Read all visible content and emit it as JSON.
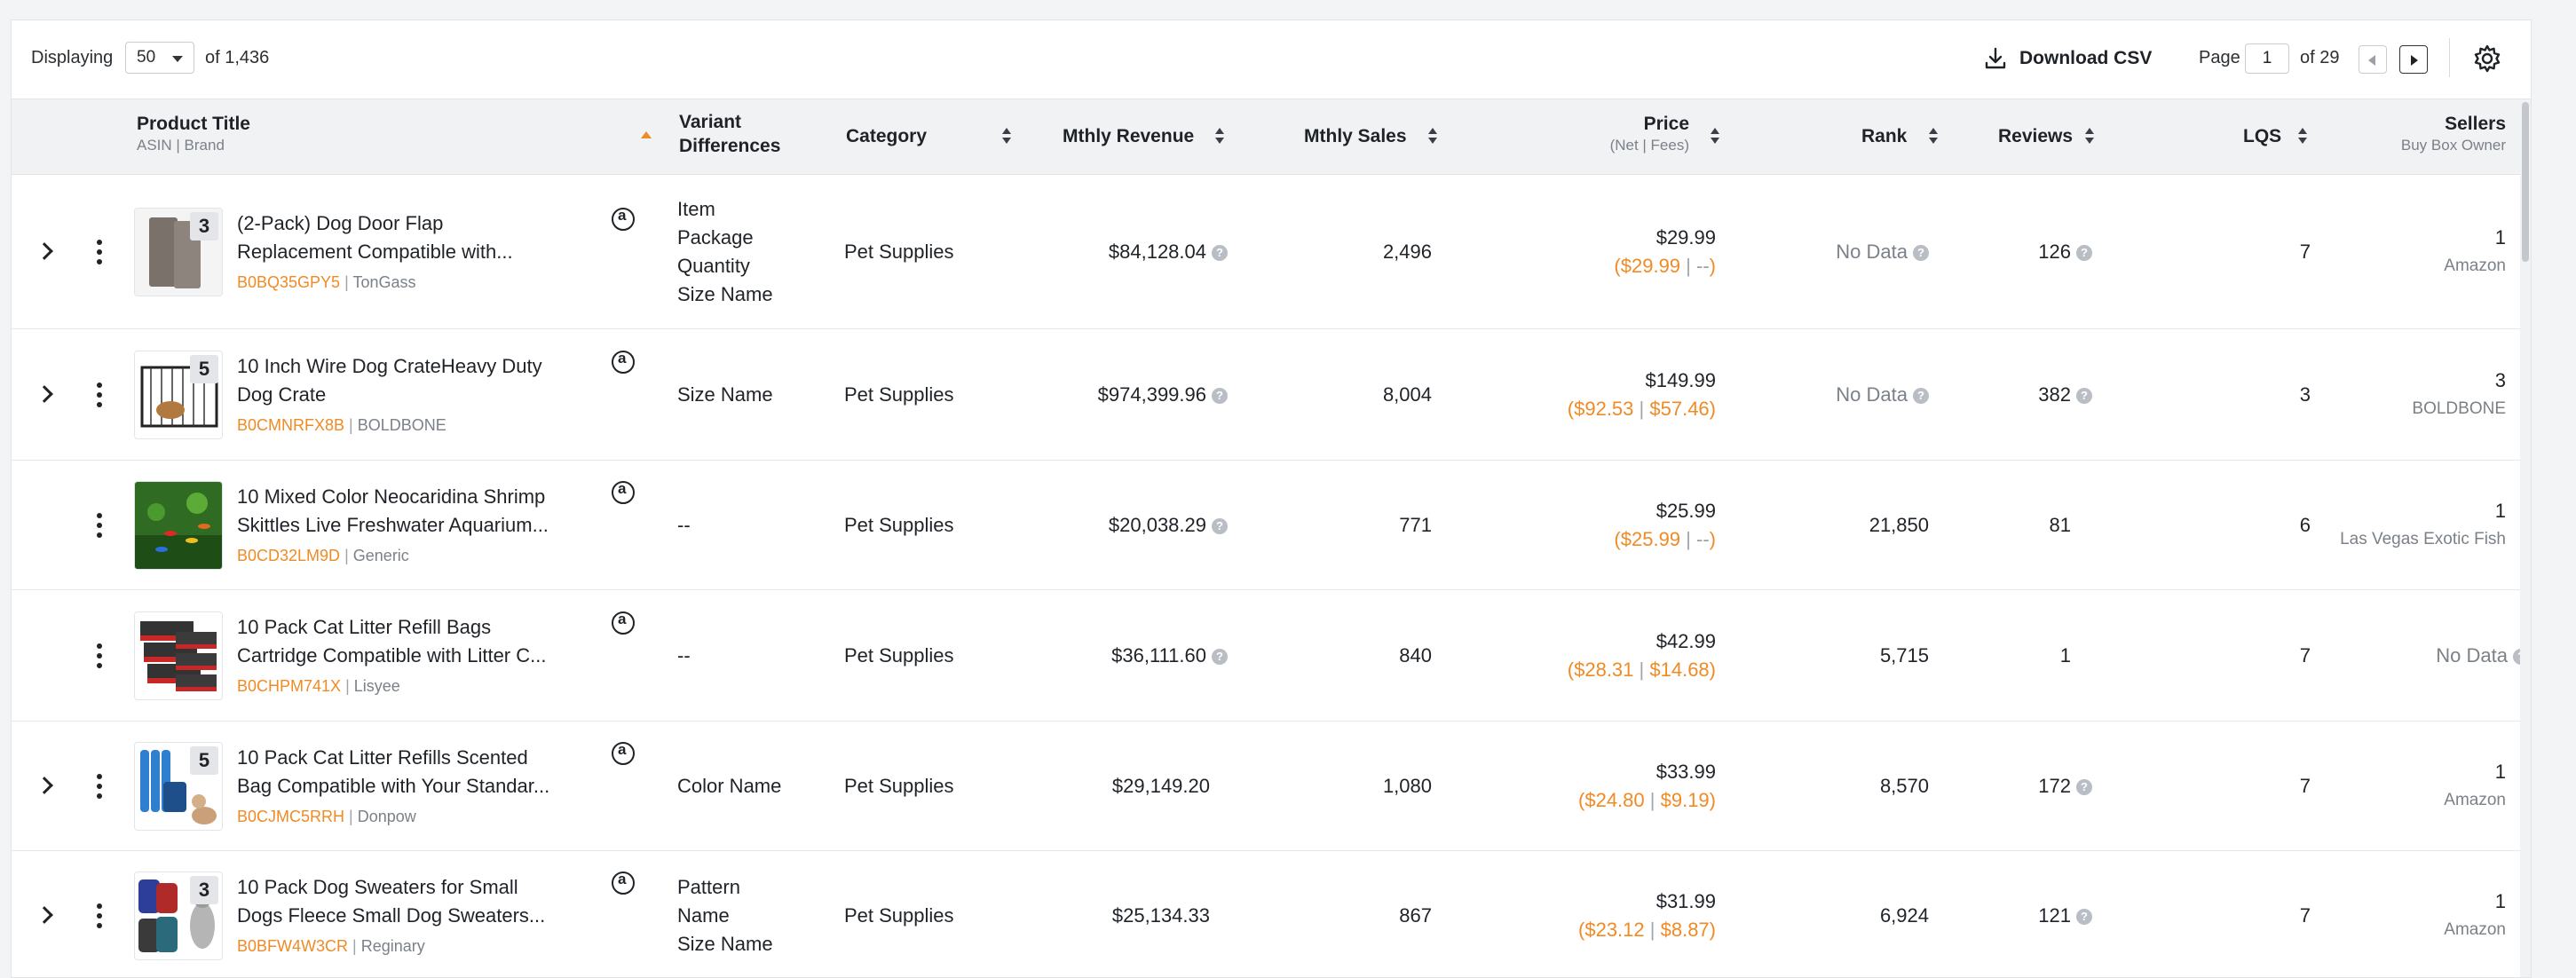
{
  "toolbar": {
    "displaying_label": "Displaying",
    "per_page": "50",
    "of_total": "of 1,436",
    "download_label": "Download CSV",
    "page_label": "Page",
    "page_value": "1",
    "of_pages": "of 29",
    "icons": [
      "download-icon",
      "prev-page-icon",
      "next-page-icon",
      "gear-icon"
    ]
  },
  "columns": {
    "title": "Product Title",
    "title_sub": "ASIN | Brand",
    "variant": "Variant Differences",
    "category": "Category",
    "revenue": "Mthly Revenue",
    "sales": "Mthly Sales",
    "price": "Price",
    "price_sub": "(Net | Fees)",
    "rank": "Rank",
    "reviews": "Reviews",
    "lqs": "LQS",
    "sellers": "Sellers",
    "sellers_sub": "Buy Box Owner"
  },
  "rows": [
    {
      "has_expand": true,
      "badge": "3",
      "title1": "(2-Pack) Dog Door Flap",
      "title2": "Replacement Compatible with...",
      "asin": "B0BQ35GPY5",
      "brand": "TonGass",
      "variant": [
        "Item",
        "Package",
        "Quantity",
        "Size Name"
      ],
      "category": "Pet Supplies",
      "revenue": "$84,128.04",
      "revenue_q": true,
      "sales": "2,496",
      "price": "$29.99",
      "net": "$29.99",
      "fees": "--",
      "rank": "No Data",
      "rank_q": true,
      "reviews": "126",
      "reviews_q": true,
      "lqs": "7",
      "sellers": "1",
      "buybox": "Amazon"
    },
    {
      "has_expand": true,
      "badge": "5",
      "title1": "10 Inch Wire Dog CrateHeavy Duty",
      "title2": "Dog Crate",
      "asin": "B0CMNRFX8B",
      "brand": "BOLDBONE",
      "variant": [
        "Size Name"
      ],
      "category": "Pet Supplies",
      "revenue": "$974,399.96",
      "revenue_q": true,
      "sales": "8,004",
      "price": "$149.99",
      "net": "$92.53",
      "fees": "$57.46",
      "rank": "No Data",
      "rank_q": true,
      "reviews": "382",
      "reviews_q": true,
      "lqs": "3",
      "sellers": "3",
      "buybox": "BOLDBONE"
    },
    {
      "has_expand": false,
      "badge": "",
      "title1": "10 Mixed Color Neocaridina Shrimp",
      "title2": "Skittles Live Freshwater Aquarium...",
      "asin": "B0CD32LM9D",
      "brand": "Generic",
      "variant": [
        "--"
      ],
      "category": "Pet Supplies",
      "revenue": "$20,038.29",
      "revenue_q": true,
      "sales": "771",
      "price": "$25.99",
      "net": "$25.99",
      "fees": "--",
      "rank": "21,850",
      "rank_q": false,
      "reviews": "81",
      "reviews_q": false,
      "lqs": "6",
      "sellers": "1",
      "buybox": "Las Vegas Exotic Fish"
    },
    {
      "has_expand": false,
      "badge": "",
      "title1": "10 Pack Cat Litter Refill Bags",
      "title2": "Cartridge Compatible with Litter C...",
      "asin": "B0CHPM741X",
      "brand": "Lisyee",
      "variant": [
        "--"
      ],
      "category": "Pet Supplies",
      "revenue": "$36,111.60",
      "revenue_q": true,
      "sales": "840",
      "price": "$42.99",
      "net": "$28.31",
      "fees": "$14.68",
      "rank": "5,715",
      "rank_q": false,
      "reviews": "1",
      "reviews_q": false,
      "lqs": "7",
      "sellers": "No Data",
      "buybox": ""
    },
    {
      "has_expand": true,
      "badge": "5",
      "title1": "10 Pack Cat Litter Refills Scented",
      "title2": "Bag Compatible with Your Standar...",
      "asin": "B0CJMC5RRH",
      "brand": "Donpow",
      "variant": [
        "Color Name"
      ],
      "category": "Pet Supplies",
      "revenue": "$29,149.20",
      "revenue_q": false,
      "sales": "1,080",
      "price": "$33.99",
      "net": "$24.80",
      "fees": "$9.19",
      "rank": "8,570",
      "rank_q": false,
      "reviews": "172",
      "reviews_q": true,
      "lqs": "7",
      "sellers": "1",
      "buybox": "Amazon"
    },
    {
      "has_expand": true,
      "badge": "3",
      "title1": "10 Pack Dog Sweaters for Small",
      "title2": "Dogs Fleece Small Dog Sweaters...",
      "asin": "B0BFW4W3CR",
      "brand": "Reginary",
      "variant": [
        "Pattern",
        "Name",
        "Size Name"
      ],
      "category": "Pet Supplies",
      "revenue": "$25,134.33",
      "revenue_q": false,
      "sales": "867",
      "price": "$31.99",
      "net": "$23.12",
      "fees": "$8.87",
      "rank": "6,924",
      "rank_q": false,
      "reviews": "121",
      "reviews_q": true,
      "lqs": "7",
      "sellers": "1",
      "buybox": "Amazon"
    }
  ]
}
